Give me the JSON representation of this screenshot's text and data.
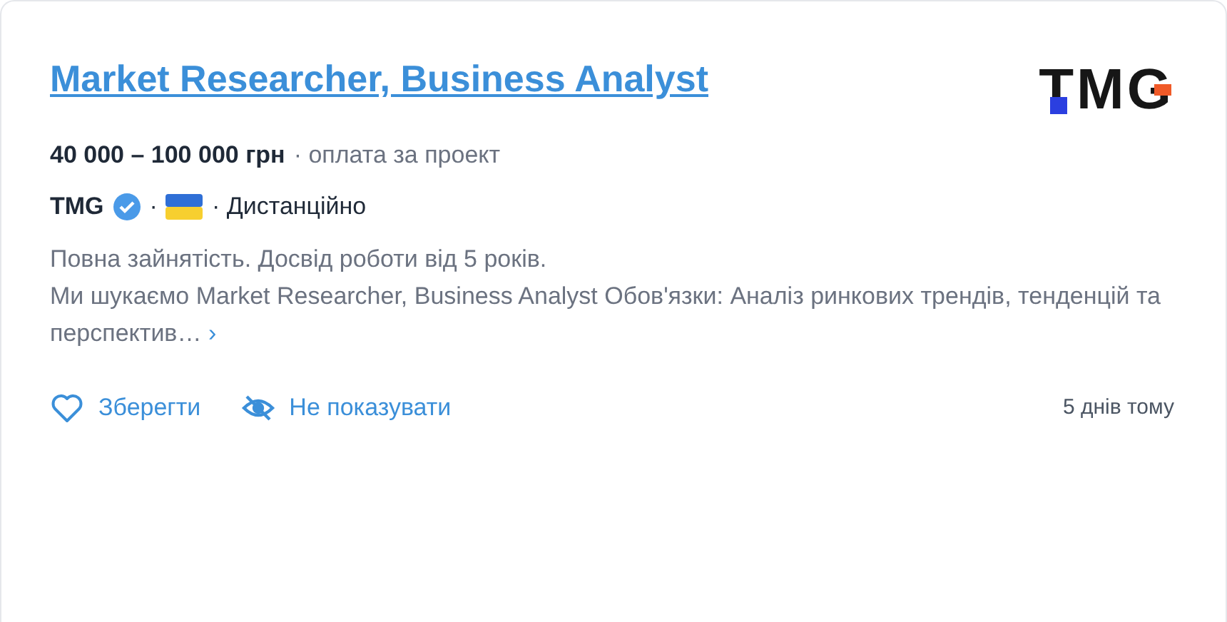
{
  "job": {
    "title": "Market Researcher, Business Analyst",
    "logo_text": "TMG",
    "salary": "40 000 – 100 000 грн",
    "payment": "· оплата за проект",
    "company": "TMG",
    "verified": true,
    "separator": "·",
    "location": "· Дистанційно",
    "description": [
      "Повна зайнятість. Досвід роботи від 5 років.",
      "Ми шукаємо Market Researcher, Business Analyst Обов'язки: Аналіз ринкових трендів, тенденцій та перспектив…"
    ],
    "more": "›"
  },
  "actions": [
    {
      "kind": "save",
      "label": "Зберегти"
    },
    {
      "kind": "hide",
      "label": "Не показувати"
    }
  ],
  "posted": "5 днів тому"
}
